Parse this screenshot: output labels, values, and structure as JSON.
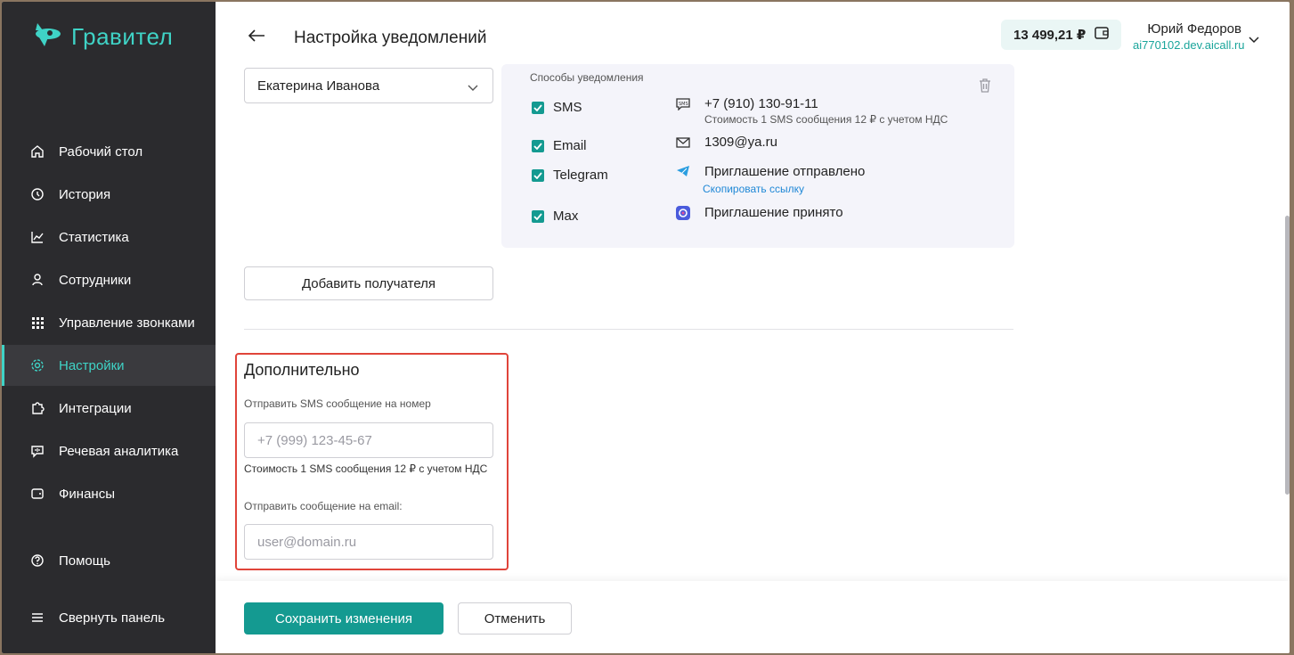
{
  "app": {
    "brand": "Гравител",
    "accent_color": "#149a91"
  },
  "sidebar": {
    "items": [
      {
        "label": "Рабочий стол",
        "icon": "home-icon"
      },
      {
        "label": "История",
        "icon": "history-icon"
      },
      {
        "label": "Статистика",
        "icon": "chart-icon"
      },
      {
        "label": "Сотрудники",
        "icon": "user-icon"
      },
      {
        "label": "Управление звонками",
        "icon": "grid-icon"
      },
      {
        "label": "Настройки",
        "icon": "gear-icon",
        "active": true
      },
      {
        "label": "Интеграции",
        "icon": "puzzle-icon"
      },
      {
        "label": "Речевая аналитика",
        "icon": "speech-icon"
      },
      {
        "label": "Финансы",
        "icon": "wallet-icon"
      }
    ],
    "help": "Помощь",
    "collapse": "Свернуть панель"
  },
  "header": {
    "title": "Настройка уведомлений",
    "balance": "13 499,21 ₽",
    "user_name": "Юрий Федоров",
    "user_domain": "ai770102.dev.aicall.ru"
  },
  "recipient": {
    "selected": "Екатерина Иванова",
    "methods_title": "Способы уведомления",
    "methods": [
      {
        "name": "SMS",
        "checked": true,
        "value": "+7 (910) 130-91-11",
        "sub": "Стоимость 1 SMS сообщения 12 ₽ с учетом НДС"
      },
      {
        "name": "Email",
        "checked": true,
        "value": "1309@ya.ru"
      },
      {
        "name": "Telegram",
        "checked": true,
        "value": "Приглашение отправлено",
        "link": "Скопировать ссылку"
      },
      {
        "name": "Max",
        "checked": true,
        "value": "Приглашение принято"
      }
    ]
  },
  "add_recipient": "Добавить получателя",
  "extra": {
    "title": "Дополнительно",
    "sms_label": "Отправить SMS сообщение на номер",
    "sms_placeholder": "+7 (999) 123-45-67",
    "sms_cost": "Стоимость 1 SMS сообщения 12 ₽ с учетом НДС",
    "email_label": "Отправить сообщение на email:",
    "email_placeholder": "user@domain.ru"
  },
  "footer": {
    "save": "Сохранить изменения",
    "cancel": "Отменить"
  }
}
